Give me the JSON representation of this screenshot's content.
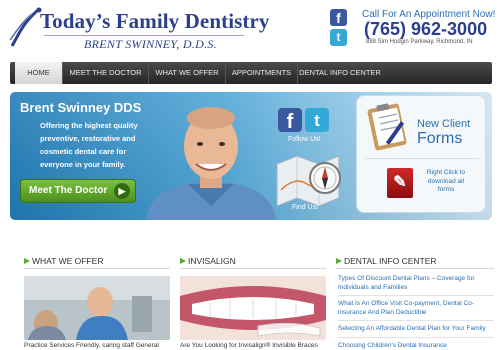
{
  "header": {
    "logo_title": "Today’s Family Dentistry",
    "logo_subtitle": "BRENT SWINNEY, D.D.S.",
    "call_label": "Call For An Appointment Now!",
    "phone": "(765) 962-3000",
    "address": "888 Sim Hodgin Parkway, Richmond, IN",
    "facebook_glyph": "f",
    "twitter_glyph": "t"
  },
  "nav": {
    "items": [
      {
        "label": "HOME",
        "active": true
      },
      {
        "label": "MEET THE DOCTOR",
        "active": false
      },
      {
        "label": "WHAT WE OFFER",
        "active": false
      },
      {
        "label": "APPOINTMENTS",
        "active": false
      },
      {
        "label": "DENTAL INFO CENTER",
        "active": false
      }
    ]
  },
  "hero": {
    "name": "Brent Swinney DDS",
    "tagline": "Offering the highest quality preventive, restorative and cosmetic dental care for everyone in your family.",
    "cta_label": "Meet The Doctor",
    "cta_arrow": "▶",
    "follow_us": "Follow Us!",
    "find_us": "Find Us!",
    "forms_title_line1": "New Client",
    "forms_title_line2": "Forms",
    "download_text": "Right Click to download all forms",
    "pdf_glyph": "✎"
  },
  "columns": {
    "offer": {
      "title": "WHAT WE OFFER",
      "text": "Practice Services Friendly, caring staff General"
    },
    "invisalign": {
      "title": "INVISALIGN",
      "text": "Are You Looking for Invisalign® Invisible Braces"
    },
    "info": {
      "title": "DENTAL INFO CENTER",
      "links": [
        "Types Of Discount Dental Plans – Coverage for Individuals and Families",
        "What Is An Office Visit Co-payment, Dental Co-insurance And Plan Deductible",
        "Selecting An Affordable Dental Plan for Your Family",
        "Choosing Children's Dental Insurance"
      ]
    }
  },
  "colors": {
    "brand_blue": "#2b3f8c",
    "link_blue": "#2a6fb3",
    "cta_green": "#5ea52c",
    "nav_dark": "#333333",
    "facebook": "#3a589e",
    "twitter": "#33a9d7"
  },
  "icons": [
    "logo-swoosh-icon",
    "facebook-icon",
    "twitter-icon",
    "map-compass-icon",
    "clipboard-icon",
    "pdf-icon",
    "arrow-right-icon"
  ]
}
